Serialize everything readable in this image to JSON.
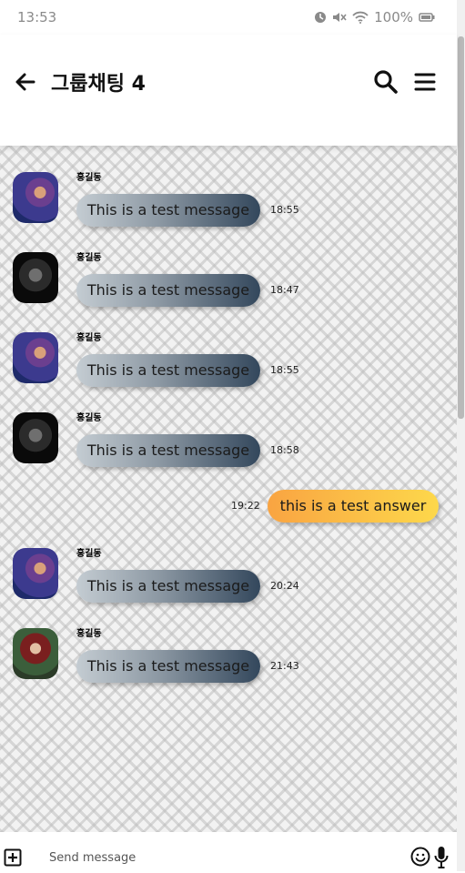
{
  "status_bar": {
    "time": "13:53",
    "battery": "100%",
    "icons": [
      "alarm-icon",
      "mute-icon",
      "wifi-icon",
      "battery-icon"
    ]
  },
  "header": {
    "title": "그룹채팅 4",
    "icons": [
      "back-arrow-icon",
      "search-icon",
      "menu-icon"
    ]
  },
  "messages": [
    {
      "sender": "홍길동",
      "text": "This is a test message",
      "time": "18:55",
      "avatar": "avatar-man-purple"
    },
    {
      "sender": "홍길동",
      "text": "This is a test message",
      "time": "18:47",
      "avatar": "avatar-dark-portrait"
    },
    {
      "sender": "홍길동",
      "text": "This is a test message",
      "time": "18:55",
      "avatar": "avatar-man-purple"
    },
    {
      "sender": "홍길동",
      "text": "This is a test message",
      "time": "18:58",
      "avatar": "avatar-dark-portrait"
    },
    {
      "sender": "홍길동",
      "text": "This is a test message",
      "time": "20:24",
      "avatar": "avatar-man-purple"
    },
    {
      "sender": "홍길동",
      "text": "This is a test message",
      "time": "21:43",
      "avatar": "avatar-woman-red"
    }
  ],
  "my_message": {
    "text": "this is a test answer",
    "time": "19:22"
  },
  "input_bar": {
    "placeholder": "Send message",
    "icons": [
      "add-box-icon",
      "emoji-icon",
      "microphone-icon"
    ]
  },
  "colors": {
    "received_bubble_start": "#c4ccd2",
    "received_bubble_end": "#33475c",
    "sent_bubble_start": "#f9a442",
    "sent_bubble_end": "#fdd84b"
  }
}
